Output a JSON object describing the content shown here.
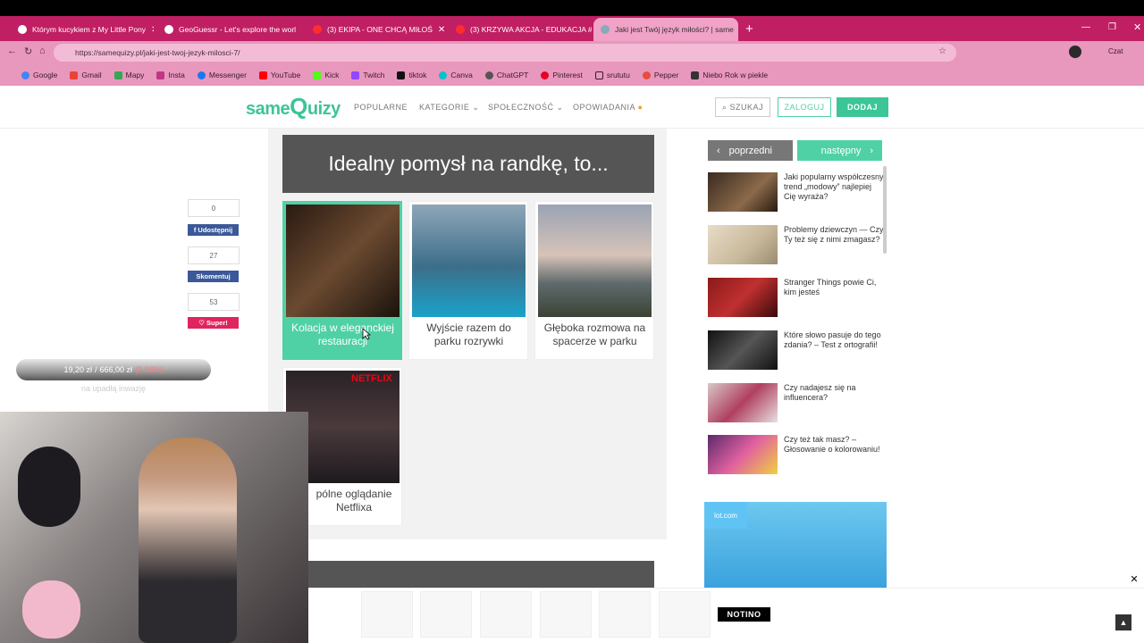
{
  "browser": {
    "tabs": [
      {
        "title": "Którym kucykiem z My Little Pony",
        "active": false
      },
      {
        "title": "GeoGuessr - Let's explore the worl",
        "active": false
      },
      {
        "title": "(3) EKIPA - ONE CHCĄ MIŁOŚ",
        "active": false
      },
      {
        "title": "(3) KRZYWA AKCJA - EDUKACJA #",
        "active": false
      },
      {
        "title": "Jaki jest Twój język miłości? | same",
        "active": true
      }
    ],
    "url": "https://samequizy.pl/jaki-jest-twoj-jezyk-milosci-7/",
    "bookmarks": [
      "Google",
      "Gmail",
      "Mapy",
      "Insta",
      "Messenger",
      "YouTube",
      "Kick",
      "Twitch",
      "tiktok",
      "Canva",
      "ChatGPT",
      "Pinterest",
      "srututu",
      "Pepper",
      "Niebo Rok w piekle"
    ],
    "profile_label": "Czat"
  },
  "site": {
    "logo": {
      "same": "same",
      "Q": "Q",
      "uizy": "uizy"
    },
    "nav": [
      "POPULARNE",
      "KATEGORIE",
      "SPOŁECZNOŚĆ",
      "OPOWIADANIA"
    ],
    "search_label": "SZUKAJ",
    "login_label": "ZALOGUJ",
    "add_label": "DODAJ"
  },
  "quiz": {
    "question": "Idealny pomysł na randkę, to...",
    "answers": [
      {
        "label": "Kolacja w eleganckiej restauracji",
        "selected": true
      },
      {
        "label": "Wyjście razem do parku rozrywki",
        "selected": false
      },
      {
        "label": "Głęboka rozmowa na spacerze w parku",
        "selected": false
      },
      {
        "label": "pólne oglądanie Netflixa",
        "selected": false
      }
    ],
    "netflix_logo": "NETFLIX"
  },
  "share": {
    "counts": [
      "0",
      "27",
      "53"
    ],
    "share_label": "Udostępnij",
    "comment_label": "Skomentuj",
    "super_label": "Super!"
  },
  "sidebar": {
    "prev_label": "poprzedni",
    "next_label": "następny",
    "items": [
      {
        "title": "Jaki popularny współczesny trend „modowy” najlepiej Cię wyraża?"
      },
      {
        "title": "Problemy dziewczyn — Czy Ty też się z nimi zmagasz?"
      },
      {
        "title": "Stranger Things powie Ci, kim jesteś"
      },
      {
        "title": "Które słowo pasuje do tego zdania? – Test z ortografii!"
      },
      {
        "title": "Czy nadajesz się na influencera?"
      },
      {
        "title": "Czy też tak masz? – Głosowanie o kolorowaniu!"
      }
    ],
    "ad_brand": "lot.com"
  },
  "donation": {
    "current": "19,20 zł",
    "separator": "/",
    "goal": "666,00 zł",
    "percent": "(2.88%)",
    "caption": "na upadłą inwazję",
    "progress_fraction": 0.0288
  },
  "bottom_ad": {
    "brand": "NOTINO"
  },
  "colors": {
    "brand_green": "#3cc596",
    "selected_green": "#4fd1a5",
    "tab_bar": "#c01f63",
    "question_bg": "#555555"
  }
}
